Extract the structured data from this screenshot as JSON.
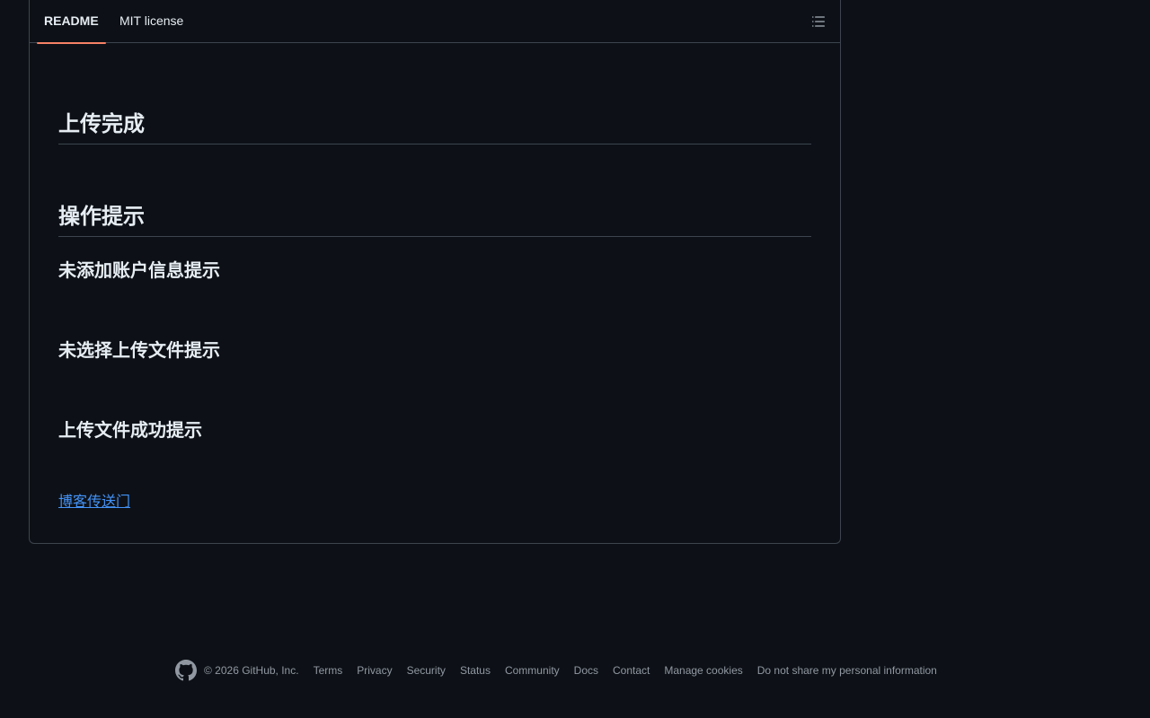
{
  "tabs": {
    "readme": "README",
    "license": "MIT license"
  },
  "icons": {
    "toc": "list-unordered-icon",
    "footer_logo": "github-mark-icon"
  },
  "content": {
    "headings": [
      "上传完成",
      "操作提示"
    ],
    "subheadings": [
      "未添加账户信息提示",
      "未选择上传文件提示",
      "上传文件成功提示"
    ],
    "blog_link": "博客传送门"
  },
  "footer": {
    "copyright": "© 2026 GitHub, Inc.",
    "links": [
      "Terms",
      "Privacy",
      "Security",
      "Status",
      "Community",
      "Docs",
      "Contact",
      "Manage cookies",
      "Do not share my personal information"
    ]
  },
  "colors": {
    "background": "#0d1117",
    "border": "#3d444d",
    "active_tab_underline": "#f78166",
    "link": "#4493f8",
    "muted_text": "#9198a1"
  }
}
